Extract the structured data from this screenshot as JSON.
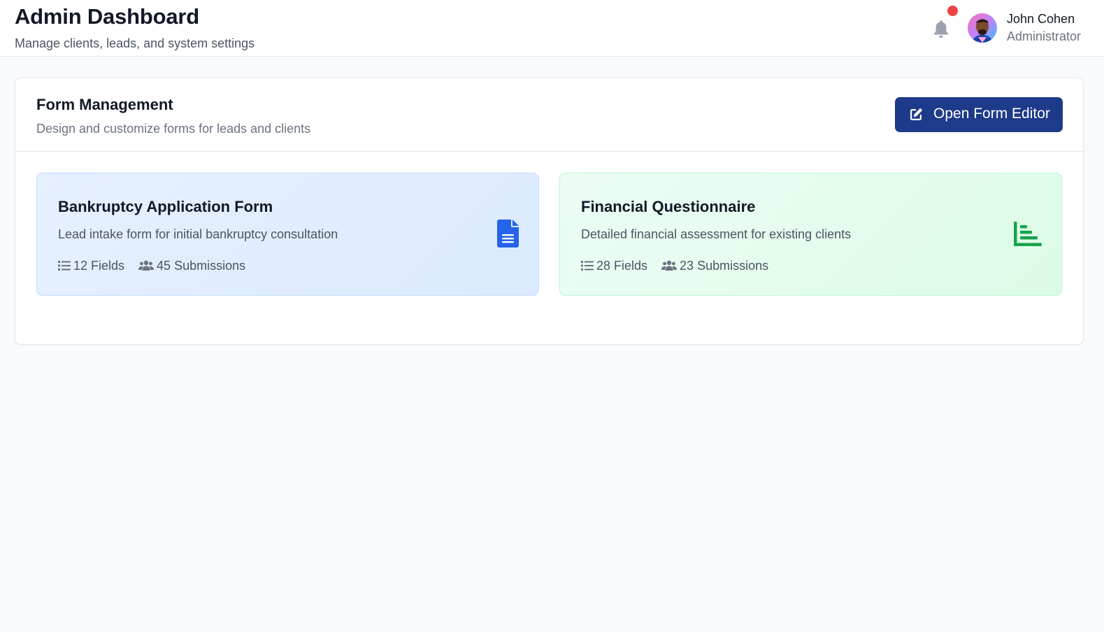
{
  "header": {
    "title": "Admin Dashboard",
    "subtitle": "Manage clients, leads, and system settings",
    "notification_icon": "bell-icon",
    "has_unread_notification": true,
    "user": {
      "name": "John Cohen",
      "role": "Administrator"
    }
  },
  "form_management": {
    "title": "Form Management",
    "subtitle": "Design and customize forms for leads and clients",
    "open_editor_label": "Open Form Editor",
    "open_editor_icon": "edit-icon",
    "forms": [
      {
        "title": "Bankruptcy Application Form",
        "description": "Lead intake form for initial bankruptcy consultation",
        "fields": "12 Fields",
        "submissions": "45 Submissions",
        "icon": "document-icon",
        "accent": "#2563eb"
      },
      {
        "title": "Financial Questionnaire",
        "description": "Detailed financial assessment for existing clients",
        "fields": "28 Fields",
        "submissions": "23 Submissions",
        "icon": "bar-chart-icon",
        "accent": "#16a34a"
      }
    ]
  },
  "colors": {
    "primary_button": "#1e3a8a",
    "notification_dot": "#ef4444",
    "background": "#f8fafc"
  }
}
